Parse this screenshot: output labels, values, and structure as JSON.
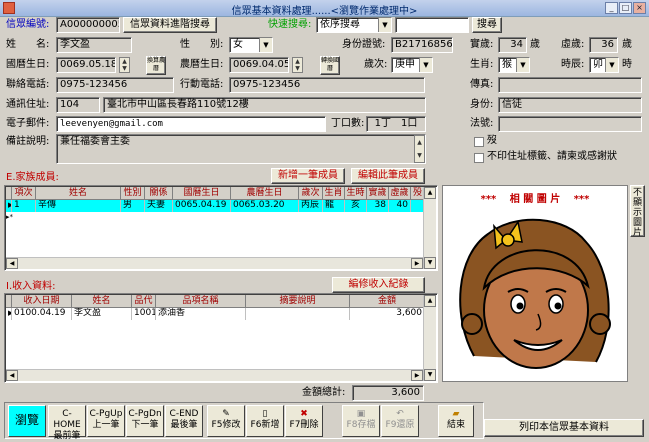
{
  "window": {
    "title": "信眾基本資料處理......<瀏覽作業處理中>"
  },
  "form": {
    "member_no_label": "信眾編號:",
    "member_no": "A000000005",
    "advanced_search_btn": "信眾資料進階搜尋",
    "quick_search_label": "快速搜尋:",
    "quick_search_select": "依序搜尋",
    "quick_search_value": "",
    "search_btn": "搜尋",
    "name_label": "姓　　名:",
    "name": "李文盈",
    "gender_label": "性　　別:",
    "gender": "女",
    "id_label": "身份證號:",
    "id_no": "B217168561",
    "nominal_age_label": "實歲:",
    "nominal_age": "34",
    "nominal_age_unit": "歲",
    "virtual_age_label": "虛歲:",
    "virtual_age": "36",
    "virtual_age_unit": "歲",
    "solar_birth_label": "國曆生日:",
    "solar_birth": "0069.05.18",
    "convert1_btn": "換算農曆",
    "lunar_birth_label": "農曆生日:",
    "lunar_birth": "0069.04.05",
    "convert2_btn": "轉換國曆",
    "year_gz_label": "歲次:",
    "year_gz": "庚申",
    "zodiac_label": "生肖:",
    "zodiac": "猴",
    "hour_label": "時辰:",
    "hour": "卯",
    "hour_unit": "時",
    "phone_label": "聯絡電話:",
    "phone": "0975-123456",
    "mobile_label": "行動電話:",
    "mobile": "0975-123456",
    "fax_label": "傳真:",
    "fax": "",
    "address_label": "通訊住址:",
    "zip": "104",
    "address": "臺北市中山區長春路110號12樓",
    "identity_label": "身份:",
    "identity": "信徒",
    "email_label": "電子郵件:",
    "email": "leevenyen@gmail.com",
    "dingkou_label": "丁口數:",
    "ding": "1丁",
    "kou": "1口",
    "dharma_label": "法號:",
    "dharma": "",
    "note_label": "備註說明:",
    "note": "兼任福委會主委",
    "deceased_label": "歿",
    "noprint_label": "不印住址標籤、請柬或感謝狀"
  },
  "family": {
    "title": "E.家族成員:",
    "add_btn": "新增一筆成員",
    "edit_btn": "編輯此筆成員",
    "headers": [
      "項次",
      "姓名",
      "性別",
      "關係",
      "國曆生日",
      "農曆生日",
      "歲次",
      "生肖",
      "生時",
      "實歲",
      "虛歲",
      "殁"
    ],
    "rows": [
      [
        "1",
        "辛傳",
        "男",
        "夫妻",
        "0065.04.19",
        "0065.03.20",
        "丙辰",
        "龍",
        "亥",
        "38",
        "40",
        ""
      ]
    ]
  },
  "income": {
    "title": "I.收入資料:",
    "edit_btn": "編修收入紀錄",
    "headers": [
      "收入日期",
      "姓名",
      "品代",
      "品項名稱",
      "摘要說明",
      "金額"
    ],
    "rows": [
      [
        "0100.04.19",
        "李文盈",
        "1001",
        "添油香",
        "",
        "3,600"
      ]
    ],
    "total_label": "金額總計:",
    "total": "3,600"
  },
  "photo": {
    "title": "***　 相 關 圖 片 　***",
    "side_btn": "不顯示圖片"
  },
  "toolbar": {
    "browse": "瀏覽",
    "first_key": "C-HOME",
    "first": "最前筆",
    "prev_key": "C-PgUp",
    "prev": "上一筆",
    "next_key": "C-PgDn",
    "next": "下一筆",
    "last_key": "C-END",
    "last": "最後筆",
    "edit": "F5修改",
    "add": "F6新增",
    "delete": "F7刪除",
    "save": "F8存檔",
    "restore": "F9還原",
    "exit": "結束",
    "print": "列印本信眾基本資料"
  }
}
